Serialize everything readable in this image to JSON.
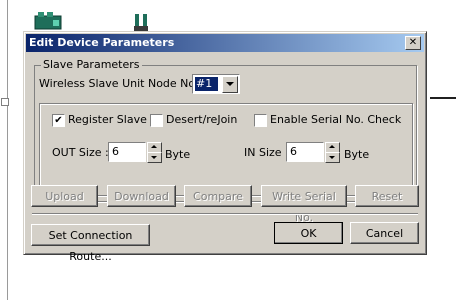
{
  "dialog": {
    "title": "Edit Device Parameters",
    "close_label": "✕"
  },
  "slave_params": {
    "group_label": "Slave Parameters",
    "node_label": "Wireless Slave Unit Node No. :",
    "node_value": "#1",
    "register_slave": {
      "label": "Register Slave",
      "checked": true,
      "mark": "✔"
    },
    "desert_rejoin": {
      "label": "Desert/reJoin",
      "checked": false
    },
    "serial_check": {
      "label": "Enable Serial No. Check",
      "checked": false
    },
    "out_size": {
      "label": "OUT Size :",
      "value": "6",
      "unit": "Byte"
    },
    "in_size": {
      "label": "IN Size :",
      "value": "6",
      "unit": "Byte"
    }
  },
  "actions": {
    "upload": "Upload",
    "download": "Download",
    "compare": "Compare",
    "write_serial": "Write Serial No.",
    "reset": "Reset"
  },
  "footer": {
    "route": "Set Connection Route...",
    "ok": "OK",
    "cancel": "Cancel"
  },
  "colors": {
    "dialog_face": "#d4d0c8",
    "title_start": "#0a246a",
    "title_end": "#a6caf0",
    "disabled_text": "#808080"
  }
}
